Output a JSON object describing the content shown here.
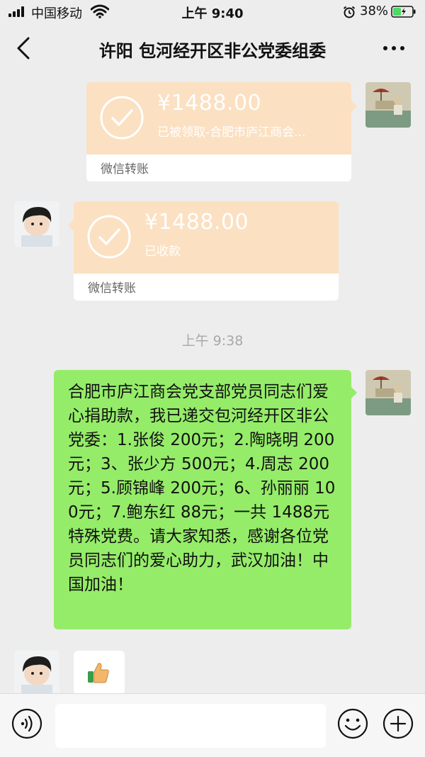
{
  "status_bar": {
    "carrier": "中国移动",
    "time": "上午 9:40",
    "battery_percent": "38%"
  },
  "nav": {
    "title": "许阳 包河经开区非公党委组委"
  },
  "messages": {
    "transfer_sent": {
      "amount": "¥1488.00",
      "status": "已被领取-合肥市庐江商会...",
      "footer": "微信转账"
    },
    "transfer_received": {
      "amount": "¥1488.00",
      "status": "已收款",
      "footer": "微信转账"
    },
    "timestamp": "上午 9:38",
    "text_message": "合肥市庐江商会党支部党员同志们爱心捐助款，我已递交包河经开区非公党委：1.张俊 200元；2.陶晓明 200元；3、张少方 500元；4.周志 200元；5.顾锦峰 200元；6、孙丽丽 100元；7.鲍东红 88元；一共 1488元特殊党费。请大家知悉，感谢各位党员同志们的爱心助力，武汉加油！中国加油！"
  },
  "colors": {
    "background": "#ededed",
    "transfer_card": "#fbe0c2",
    "my_bubble": "#95ec69",
    "timestamp": "#a8a8a8",
    "battery_charge": "#4cd964"
  },
  "icons": {
    "back": "chevron-left-icon",
    "more": "more-dots-icon",
    "check": "check-circle-icon",
    "thumbs_up": "thumbs-up-icon",
    "voice": "voice-icon",
    "emoji": "emoji-icon",
    "plus": "plus-icon"
  }
}
